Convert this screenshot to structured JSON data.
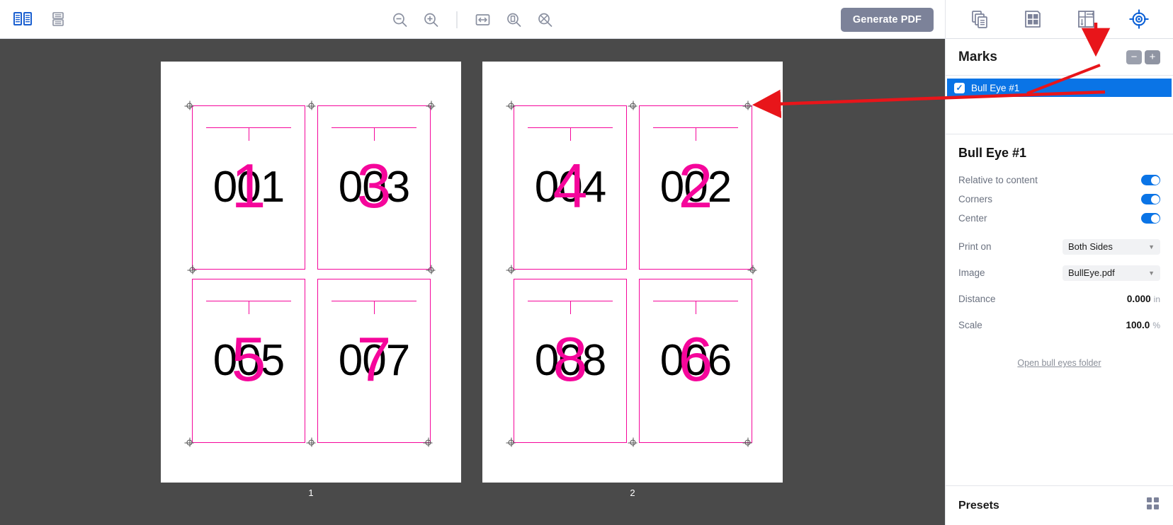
{
  "toolbar": {
    "left_icons": [
      {
        "name": "two-page-spread-icon",
        "state": "active"
      },
      {
        "name": "save-layout-icon",
        "state": "default"
      }
    ],
    "zoom_icons": [
      {
        "name": "zoom-out-icon"
      },
      {
        "name": "zoom-in-icon"
      },
      {
        "name": "fit-width-icon"
      },
      {
        "name": "fit-page-icon"
      },
      {
        "name": "reset-zoom-icon"
      }
    ],
    "generate_label": "Generate PDF",
    "generate_color": "#7c8299"
  },
  "canvas": {
    "background": "#4a4a4a",
    "mark_color": "#f5069b",
    "sheets": [
      {
        "label": "1",
        "cells": [
          {
            "number": "001",
            "bull": "1"
          },
          {
            "number": "003",
            "bull": "3"
          },
          {
            "number": "005",
            "bull": "5"
          },
          {
            "number": "007",
            "bull": "7"
          }
        ]
      },
      {
        "label": "2",
        "cells": [
          {
            "number": "004",
            "bull": "4"
          },
          {
            "number": "002",
            "bull": "2"
          },
          {
            "number": "008",
            "bull": "8"
          },
          {
            "number": "006",
            "bull": "6"
          }
        ]
      }
    ]
  },
  "panel": {
    "tabs": [
      {
        "name": "pages-icon",
        "active": false
      },
      {
        "name": "layout-grid-icon",
        "active": false
      },
      {
        "name": "imposition-icon",
        "active": false
      },
      {
        "name": "bullseye-marks-icon",
        "active": true
      }
    ],
    "accent": "#0a74e6",
    "marks": {
      "title": "Marks",
      "remove_label": "−",
      "add_label": "+",
      "items": [
        {
          "label": "Bull Eye #1",
          "checked": true,
          "selected": true
        }
      ]
    },
    "properties": {
      "title": "Bull Eye #1",
      "toggles": [
        {
          "label": "Relative to content",
          "on": true
        },
        {
          "label": "Corners",
          "on": true
        },
        {
          "label": "Center",
          "on": true
        }
      ],
      "print_on": {
        "label": "Print on",
        "value": "Both Sides"
      },
      "image": {
        "label": "Image",
        "value": "BullEye.pdf"
      },
      "distance": {
        "label": "Distance",
        "value": "0.000",
        "unit": "in"
      },
      "scale": {
        "label": "Scale",
        "value": "100.0",
        "unit": "%"
      },
      "folder_link": "Open bull eyes folder"
    },
    "presets": {
      "title": "Presets",
      "icon": "grid-icon"
    }
  },
  "annotations": {
    "color": "#e8151a",
    "arrows": [
      {
        "name": "arrow-to-add-mark-button",
        "from": "above",
        "to": "add-button"
      },
      {
        "name": "arrow-to-page-corner-mark",
        "from": "mark-list-row",
        "to": "sheet-2-corner"
      }
    ]
  }
}
